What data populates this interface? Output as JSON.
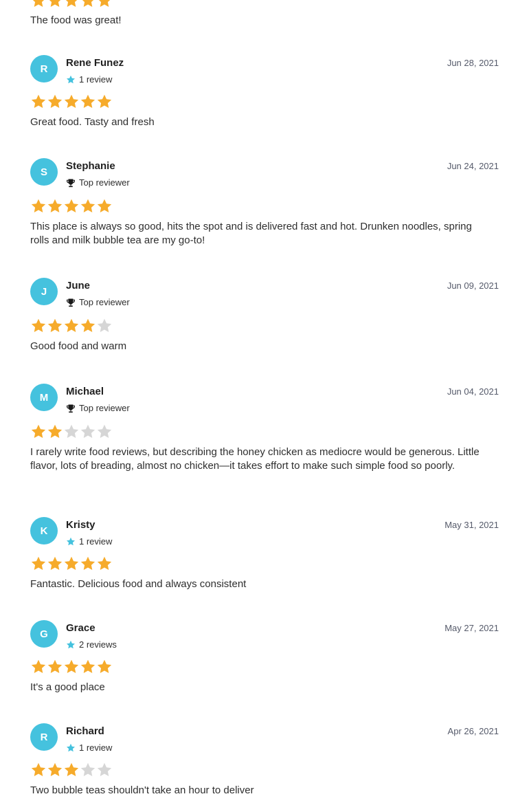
{
  "top_review": {
    "rating": 5,
    "text": "The food was great!"
  },
  "colors": {
    "avatar": "#45c2de",
    "star_filled": "#f6ab2b",
    "star_empty": "#d6d6d6",
    "badge_star": "#45c2de"
  },
  "reviews": [
    {
      "initial": "R",
      "name": "Rene Funez",
      "badge_icon": "star-icon",
      "badge": "1 review",
      "date": "Jun 28, 2021",
      "rating": 5,
      "text": "Great food. Tasty and fresh"
    },
    {
      "initial": "S",
      "name": "Stephanie",
      "badge_icon": "trophy-icon",
      "badge": "Top reviewer",
      "date": "Jun 24, 2021",
      "rating": 5,
      "text": "This place is always so good, hits the spot and is delivered fast and hot. Drunken noodles, spring rolls and milk bubble tea are my go-to!"
    },
    {
      "initial": "J",
      "name": "June",
      "badge_icon": "trophy-icon",
      "badge": "Top reviewer",
      "date": "Jun 09, 2021",
      "rating": 4,
      "text": "Good food and warm"
    },
    {
      "initial": "M",
      "name": "Michael",
      "badge_icon": "trophy-icon",
      "badge": "Top reviewer",
      "date": "Jun 04, 2021",
      "rating": 2,
      "text": "I rarely write food reviews, but describing the honey chicken as mediocre would be generous. Little flavor, lots of breading, almost no chicken—it takes effort to make such simple food so poorly."
    },
    {
      "initial": "K",
      "name": "Kristy",
      "badge_icon": "star-icon",
      "badge": "1 review",
      "date": "May 31, 2021",
      "rating": 5,
      "text": "Fantastic. Delicious food and always consistent"
    },
    {
      "initial": "G",
      "name": "Grace",
      "badge_icon": "star-icon",
      "badge": "2 reviews",
      "date": "May 27, 2021",
      "rating": 5,
      "text": "It's a good place"
    },
    {
      "initial": "R",
      "name": "Richard",
      "badge_icon": "star-icon",
      "badge": "1 review",
      "date": "Apr 26, 2021",
      "rating": 3,
      "text": "Two bubble teas shouldn't take an hour to deliver"
    }
  ]
}
